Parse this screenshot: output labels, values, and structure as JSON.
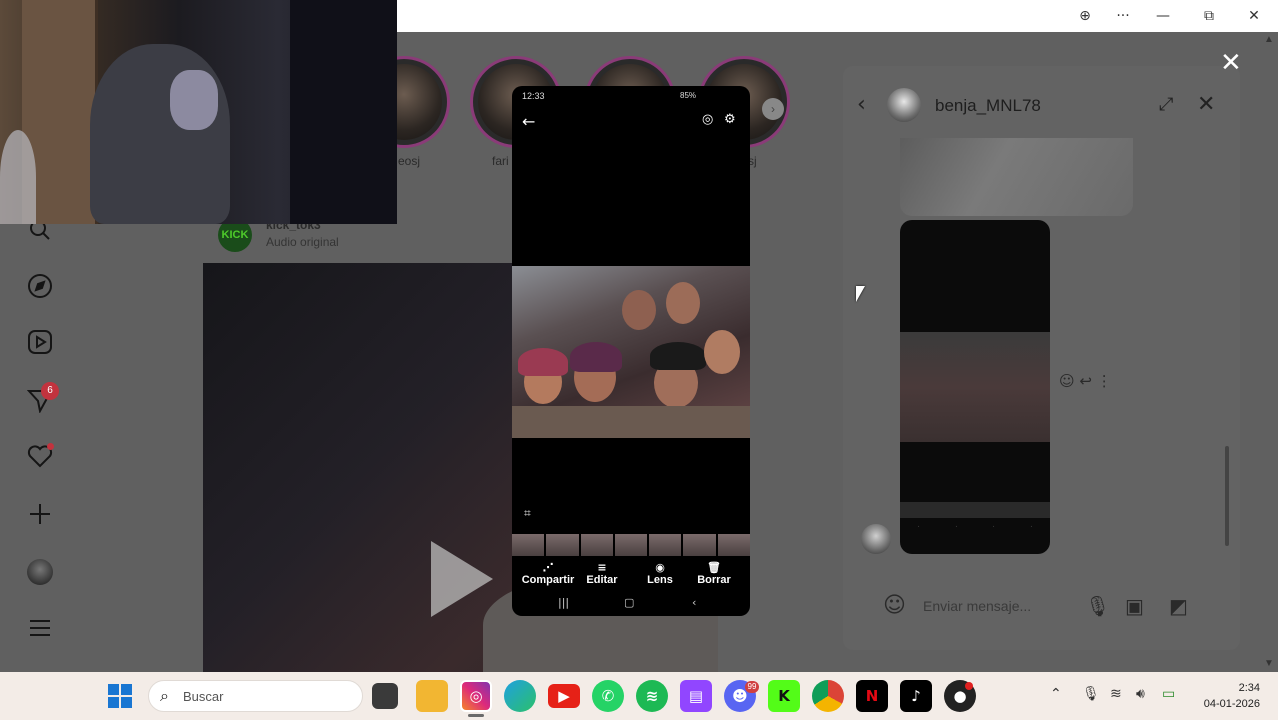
{
  "window": {
    "zoom_icon": "zoom-icon",
    "more_label": "···",
    "minimize_label": "—",
    "restore_label": "⧉",
    "close_label": "✕"
  },
  "stories": [
    {
      "label": "eosj"
    },
    {
      "label": "fari"
    },
    {
      "label": ""
    },
    {
      "label": "sj"
    }
  ],
  "post": {
    "author_logo": "KICK",
    "author": "kick_tok3",
    "audio": "Audio original"
  },
  "sidebar": {
    "notification_count": "6"
  },
  "phone": {
    "time": "12:33",
    "battery": "85%",
    "actions": [
      {
        "label": "Compartir",
        "icon": "share-icon"
      },
      {
        "label": "Editar",
        "icon": "edit-icon"
      },
      {
        "label": "Lens",
        "icon": "lens-icon"
      },
      {
        "label": "Borrar",
        "icon": "trash-icon"
      }
    ]
  },
  "chat": {
    "username": "benja_MNL78",
    "input_placeholder": "Enviar mensaje..."
  },
  "taskbar": {
    "search_label": "Buscar",
    "discord_badge": "99",
    "time": "2:34",
    "date": "04-01-2026"
  },
  "colors": {
    "accent_badge": "#c2333e",
    "story_ring": "#8a3b78",
    "windows_blue": "#1976d2"
  }
}
